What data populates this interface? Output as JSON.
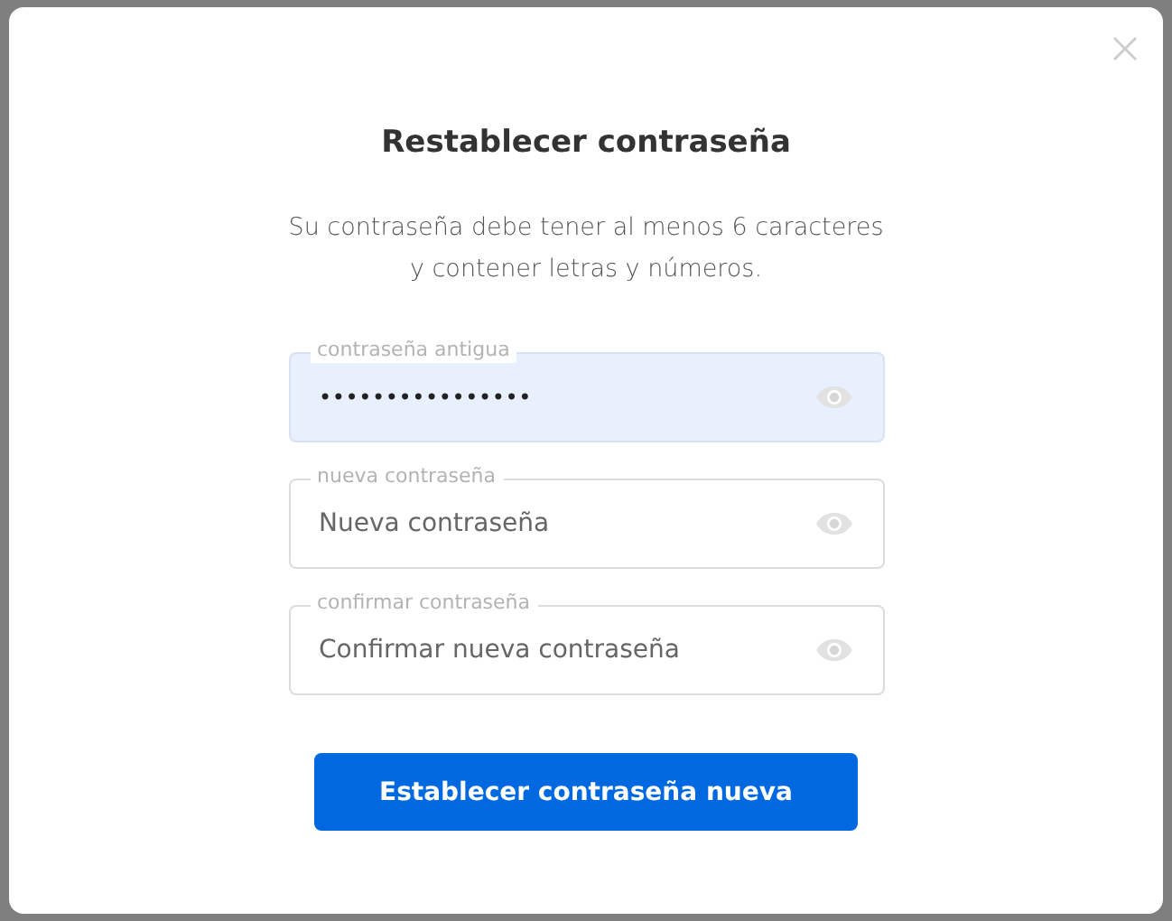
{
  "dialog": {
    "title": "Restablecer contraseña",
    "description_lines": [
      "Su contraseña debe tener al menos 6 caracteres",
      "y contener letras y números."
    ],
    "fields": [
      {
        "label": "contraseña antigua",
        "value": "••••••••••••••••",
        "autofilled": true
      },
      {
        "label": "nueva contraseña",
        "placeholder": "Nueva contraseña",
        "autofilled": false
      },
      {
        "label": "confirmar contraseña",
        "placeholder": "Confirmar nueva contraseña",
        "autofilled": false
      }
    ],
    "submit_button": "Establecer contraseña nueva"
  }
}
